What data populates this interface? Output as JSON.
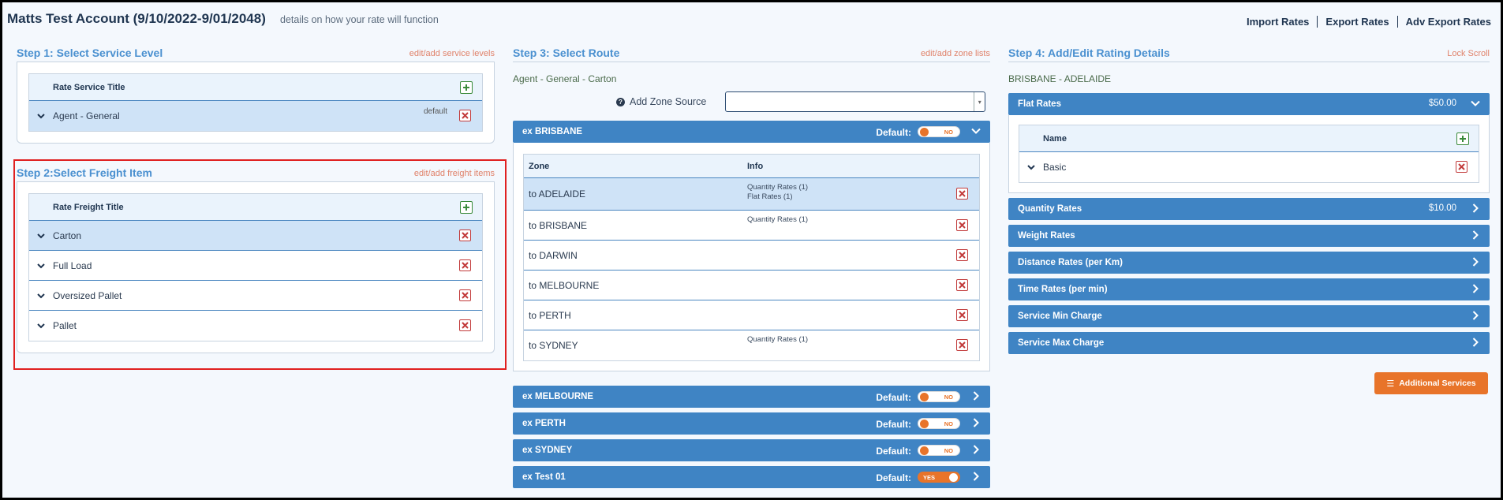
{
  "header": {
    "title": "Matts Test Account (9/10/2022-9/01/2048)",
    "subtitle": "details on how your rate will function",
    "links": [
      "Import Rates",
      "Export Rates",
      "Adv Export Rates"
    ]
  },
  "step1": {
    "title": "Step 1: Select Service Level",
    "link": "edit/add service levels",
    "column_header": "Rate Service Title",
    "rows": [
      {
        "label": "Agent - General",
        "tag": "default",
        "selected": true
      }
    ]
  },
  "step2": {
    "title": "Step 2:Select Freight Item",
    "link": "edit/add freight items",
    "column_header": "Rate Freight Title",
    "rows": [
      {
        "label": "Carton",
        "selected": true
      },
      {
        "label": "Full Load",
        "selected": false
      },
      {
        "label": "Oversized Pallet",
        "selected": false
      },
      {
        "label": "Pallet",
        "selected": false
      }
    ]
  },
  "step3": {
    "title": "Step 3: Select Route",
    "link": "edit/add zone lists",
    "route_label": "Agent - General - Carton",
    "zone_source_label": "Add Zone Source",
    "zone_source_value": "",
    "default_label": "Default:",
    "origins": [
      {
        "name": "ex BRISBANE",
        "default": "NO",
        "expanded": true,
        "columns": [
          "Zone",
          "Info"
        ],
        "zones": [
          {
            "zone": "to ADELAIDE",
            "info": [
              "Quantity Rates (1)",
              "Flat Rates (1)"
            ],
            "selected": true
          },
          {
            "zone": "to BRISBANE",
            "info": [
              "Quantity Rates (1)"
            ],
            "selected": false
          },
          {
            "zone": "to DARWIN",
            "info": [],
            "selected": false
          },
          {
            "zone": "to MELBOURNE",
            "info": [],
            "selected": false
          },
          {
            "zone": "to PERTH",
            "info": [],
            "selected": false
          },
          {
            "zone": "to SYDNEY",
            "info": [
              "Quantity Rates (1)"
            ],
            "selected": false
          }
        ]
      },
      {
        "name": "ex MELBOURNE",
        "default": "NO",
        "expanded": false
      },
      {
        "name": "ex PERTH",
        "default": "NO",
        "expanded": false
      },
      {
        "name": "ex SYDNEY",
        "default": "NO",
        "expanded": false
      },
      {
        "name": "ex Test 01",
        "default": "YES",
        "expanded": false
      }
    ]
  },
  "step4": {
    "title": "Step 4: Add/Edit Rating Details",
    "link": "Lock Scroll",
    "route_label": "BRISBANE - ADELAIDE",
    "flat_rates": {
      "label": "Flat Rates",
      "price": "$50.00",
      "column_header": "Name",
      "rows": [
        {
          "label": "Basic"
        }
      ]
    },
    "rate_sections": [
      {
        "label": "Quantity Rates",
        "price": "$10.00"
      },
      {
        "label": "Weight Rates",
        "price": ""
      },
      {
        "label": "Distance Rates (per Km)",
        "price": ""
      },
      {
        "label": "Time Rates (per min)",
        "price": ""
      },
      {
        "label": "Service Min Charge",
        "price": ""
      },
      {
        "label": "Service Max Charge",
        "price": ""
      }
    ],
    "additional_services": "Additional Services"
  },
  "colors": {
    "accent_blue": "#3f84c4",
    "title_blue": "#4a90d0",
    "link_salmon": "#e0826a",
    "orange": "#e8742a",
    "highlight_red": "#e02020",
    "selected_row": "#cfe3f7"
  }
}
